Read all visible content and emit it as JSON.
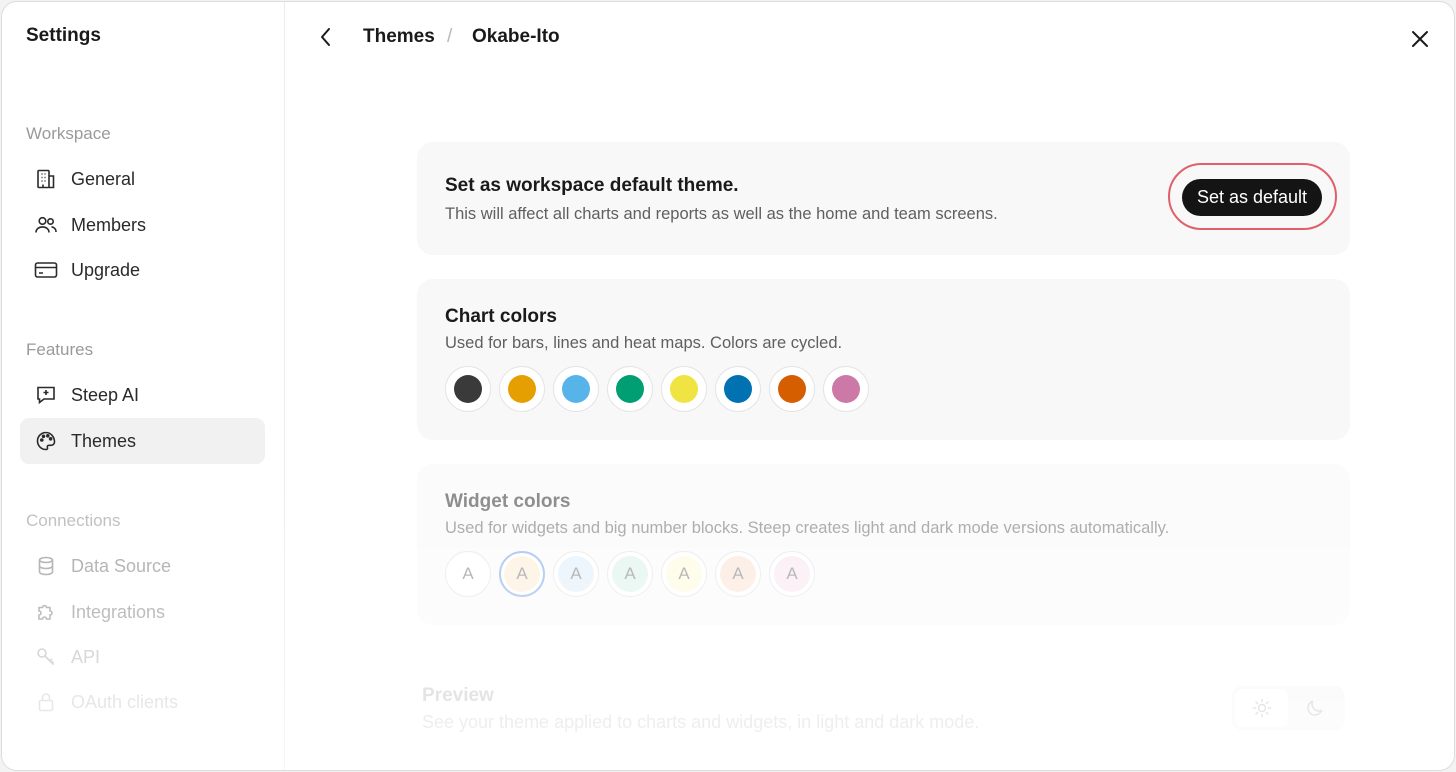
{
  "sidebar": {
    "title": "Settings",
    "sections": {
      "workspace": "Workspace",
      "features": "Features",
      "connections": "Connections"
    },
    "items": {
      "general": "General",
      "members": "Members",
      "upgrade": "Upgrade",
      "steep_ai": "Steep AI",
      "themes": "Themes",
      "data_source": "Data Source",
      "integrations": "Integrations",
      "api": "API",
      "oauth": "OAuth clients"
    },
    "active_item": "Themes"
  },
  "header": {
    "breadcrumb_parent": "Themes",
    "breadcrumb_separator": "/",
    "breadcrumb_current": "Okabe-Ito"
  },
  "default_card": {
    "title": "Set as workspace default theme.",
    "subtitle": "This will affect all charts and reports as well as the home and team screens.",
    "button_label": "Set as default"
  },
  "chart_colors": {
    "title": "Chart colors",
    "subtitle": "Used for bars, lines and heat maps. Colors are cycled.",
    "colors": [
      "#3a3a3a",
      "#e69f00",
      "#56b4e9",
      "#009e73",
      "#f0e442",
      "#0072b2",
      "#d55e00",
      "#cc79a7"
    ]
  },
  "widget_colors": {
    "title": "Widget colors",
    "subtitle": "Used for widgets and big number blocks. Steep creates light and dark mode versions automatically.",
    "swatch_letter": "A",
    "backgrounds": [
      "#ffffff",
      "#fdf3e3",
      "#eaf4fc",
      "#e6f6f1",
      "#fefbe6",
      "#fbece3",
      "#faeef4"
    ],
    "selected_index": 1
  },
  "preview": {
    "title": "Preview",
    "subtitle": "See your theme applied to charts and widgets, in light and dark mode.",
    "modes": [
      "sun-icon",
      "moon-icon"
    ]
  },
  "colors": {
    "accent_ring": "#e0606a",
    "primary_button": "#141414"
  }
}
